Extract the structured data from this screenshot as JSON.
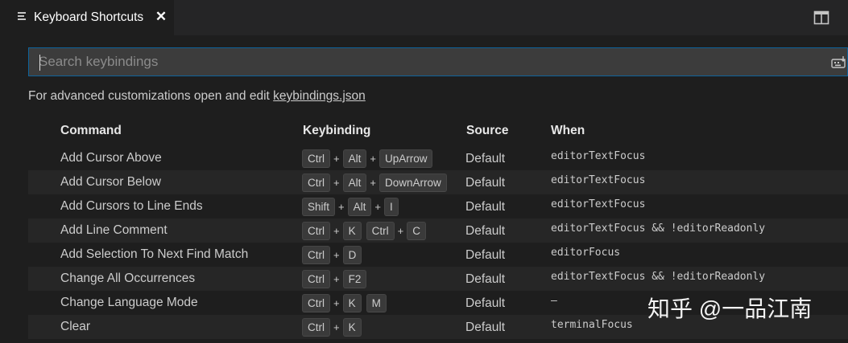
{
  "tab": {
    "title": "Keyboard Shortcuts",
    "close": "✕"
  },
  "search": {
    "placeholder": "Search keybindings",
    "value": ""
  },
  "hint": {
    "text": "For advanced customizations open and edit ",
    "link": "keybindings.json"
  },
  "columns": {
    "command": "Command",
    "keybinding": "Keybinding",
    "source": "Source",
    "when": "When"
  },
  "rows": [
    {
      "command": "Add Cursor Above",
      "keys": [
        [
          "Ctrl",
          "Alt",
          "UpArrow"
        ]
      ],
      "source": "Default",
      "when": "editorTextFocus"
    },
    {
      "command": "Add Cursor Below",
      "keys": [
        [
          "Ctrl",
          "Alt",
          "DownArrow"
        ]
      ],
      "source": "Default",
      "when": "editorTextFocus"
    },
    {
      "command": "Add Cursors to Line Ends",
      "keys": [
        [
          "Shift",
          "Alt",
          "I"
        ]
      ],
      "source": "Default",
      "when": "editorTextFocus"
    },
    {
      "command": "Add Line Comment",
      "keys": [
        [
          "Ctrl",
          "K"
        ],
        [
          "Ctrl",
          "C"
        ]
      ],
      "source": "Default",
      "when": "editorTextFocus && !editorReadonly"
    },
    {
      "command": "Add Selection To Next Find Match",
      "keys": [
        [
          "Ctrl",
          "D"
        ]
      ],
      "source": "Default",
      "when": "editorFocus"
    },
    {
      "command": "Change All Occurrences",
      "keys": [
        [
          "Ctrl",
          "F2"
        ]
      ],
      "source": "Default",
      "when": "editorTextFocus && !editorReadonly"
    },
    {
      "command": "Change Language Mode",
      "keys": [
        [
          "Ctrl",
          "K"
        ],
        [
          "M"
        ]
      ],
      "source": "Default",
      "when": "—"
    },
    {
      "command": "Clear",
      "keys": [
        [
          "Ctrl",
          "K"
        ]
      ],
      "source": "Default",
      "when": "terminalFocus"
    }
  ],
  "watermark": "知乎 @一品江南"
}
